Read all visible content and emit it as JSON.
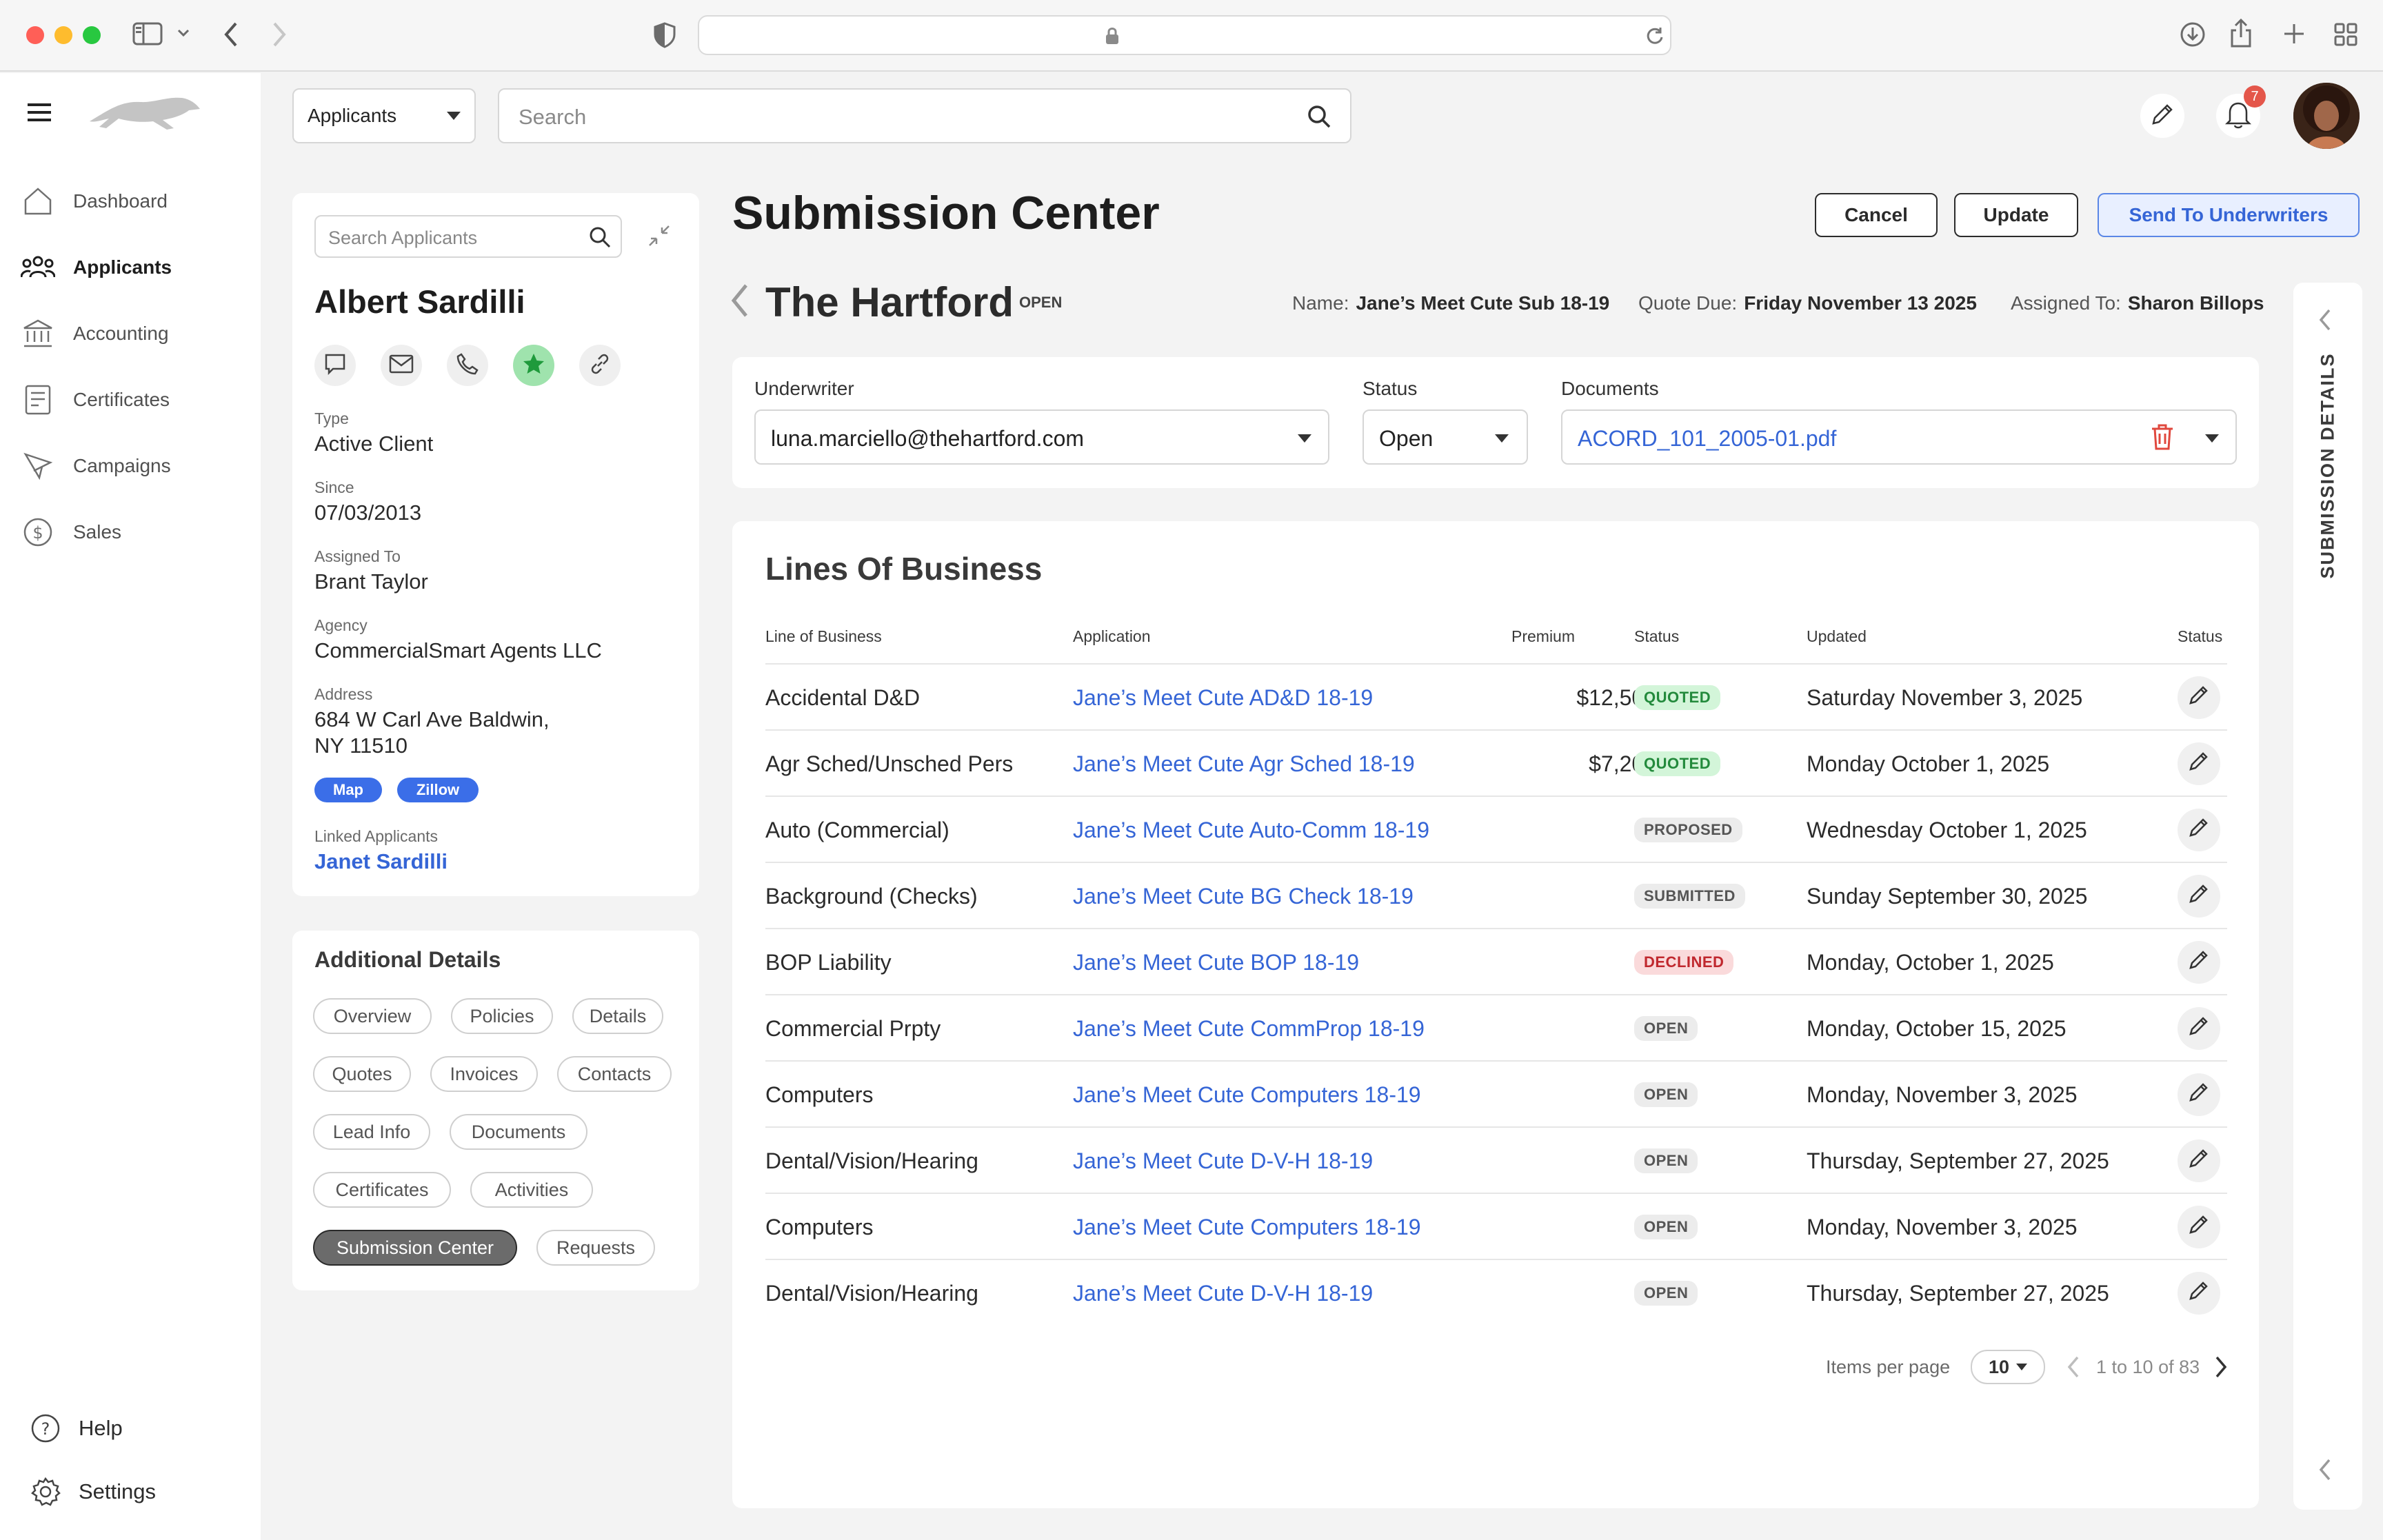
{
  "nav": {
    "items": [
      {
        "label": "Dashboard",
        "icon": "home-icon"
      },
      {
        "label": "Applicants",
        "icon": "users-icon",
        "active": true
      },
      {
        "label": "Accounting",
        "icon": "bank-icon"
      },
      {
        "label": "Certificates",
        "icon": "certificate-icon"
      },
      {
        "label": "Campaigns",
        "icon": "megaphone-icon"
      },
      {
        "label": "Sales",
        "icon": "dollar-icon"
      }
    ],
    "help_label": "Help",
    "settings_label": "Settings"
  },
  "topbar": {
    "scope_selected": "Applicants",
    "search_placeholder": "Search",
    "notification_count": "7"
  },
  "applicant": {
    "search_placeholder": "Search Applicants",
    "name": "Albert Sardilli",
    "type_label": "Type",
    "type": "Active Client",
    "since_label": "Since",
    "since": "07/03/2013",
    "assigned_label": "Assigned To",
    "assigned": "Brant Taylor",
    "agency_label": "Agency",
    "agency": "CommercialSmart Agents LLC",
    "address_label": "Address",
    "address_line1": "684 W Carl Ave Baldwin,",
    "address_line2": "NY 11510",
    "map_label": "Map",
    "zillow_label": "Zillow",
    "linked_label": "Linked Applicants",
    "linked": "Janet Sardilli"
  },
  "additional": {
    "title": "Additional Details",
    "pills": [
      "Overview",
      "Policies",
      "Details",
      "Quotes",
      "Invoices",
      "Contacts",
      "Lead Info",
      "Documents",
      "Certificates",
      "Activities",
      "Submission Center",
      "Requests"
    ],
    "active": "Submission Center"
  },
  "page": {
    "title": "Submission Center",
    "cancel": "Cancel",
    "update": "Update",
    "send": "Send To Underwriters"
  },
  "carrier": {
    "name": "The Hartford",
    "status": "OPEN",
    "name_label": "Name:",
    "sub_name": "Jane’s Meet Cute Sub 18-19",
    "due_label": "Quote Due:",
    "due": "Friday November 13 2025",
    "assigned_label": "Assigned To:",
    "assigned": "Sharon Billops"
  },
  "form": {
    "underwriter_label": "Underwriter",
    "underwriter": "luna.marciello@thehartford.com",
    "status_label": "Status",
    "status": "Open",
    "documents_label": "Documents",
    "document": "ACORD_101_2005-01.pdf"
  },
  "lob": {
    "title": "Lines Of Business",
    "headers": {
      "line": "Line of Business",
      "application": "Application",
      "premium": "Premium",
      "status": "Status",
      "updated": "Updated",
      "action": "Status"
    },
    "rows": [
      {
        "line": "Accidental D&D",
        "app": "Jane’s Meet Cute AD&D 18-19",
        "premium": "$12,500",
        "status": "QUOTED",
        "updated": "Saturday November 3, 2025"
      },
      {
        "line": "Agr Sched/Unsched Pers",
        "app": "Jane’s Meet Cute Agr Sched 18-19",
        "premium": "$7,200",
        "status": "QUOTED",
        "updated": "Monday October 1, 2025"
      },
      {
        "line": "Auto (Commercial)",
        "app": "Jane’s Meet Cute Auto-Comm 18-19",
        "premium": "--",
        "status": "PROPOSED",
        "updated": "Wednesday October 1, 2025"
      },
      {
        "line": "Background (Checks)",
        "app": "Jane’s Meet Cute BG Check 18-19",
        "premium": "--",
        "status": "SUBMITTED",
        "updated": "Sunday September 30, 2025"
      },
      {
        "line": "BOP Liability",
        "app": "Jane’s Meet Cute BOP 18-19",
        "premium": "--",
        "status": "DECLINED",
        "updated": "Monday, October 1, 2025"
      },
      {
        "line": "Commercial Prpty",
        "app": "Jane’s Meet Cute CommProp 18-19",
        "premium": "--",
        "status": "OPEN",
        "updated": "Monday, October 15, 2025"
      },
      {
        "line": "Computers",
        "app": "Jane’s Meet Cute Computers 18-19",
        "premium": "--",
        "status": "OPEN",
        "updated": "Monday, November 3, 2025"
      },
      {
        "line": "Dental/Vision/Hearing",
        "app": "Jane’s Meet Cute D-V-H 18-19",
        "premium": "--",
        "status": "OPEN",
        "updated": "Thursday, September 27, 2025"
      },
      {
        "line": "Computers",
        "app": "Jane’s Meet Cute Computers 18-19",
        "premium": "--",
        "status": "OPEN",
        "updated": "Monday, November 3, 2025"
      },
      {
        "line": "Dental/Vision/Hearing",
        "app": "Jane’s Meet Cute D-V-H 18-19",
        "premium": "--",
        "status": "OPEN",
        "updated": "Thursday, September 27, 2025"
      }
    ],
    "items_per_page_label": "Items per page",
    "items_per_page": "10",
    "range": "1 to 10 of 83"
  },
  "right_panel": {
    "label": "SUBMISSION DETAILS"
  },
  "colors": {
    "accent": "#3565d6",
    "quoted_bg": "#d3f5d9",
    "declined_bg": "#fadadb"
  }
}
